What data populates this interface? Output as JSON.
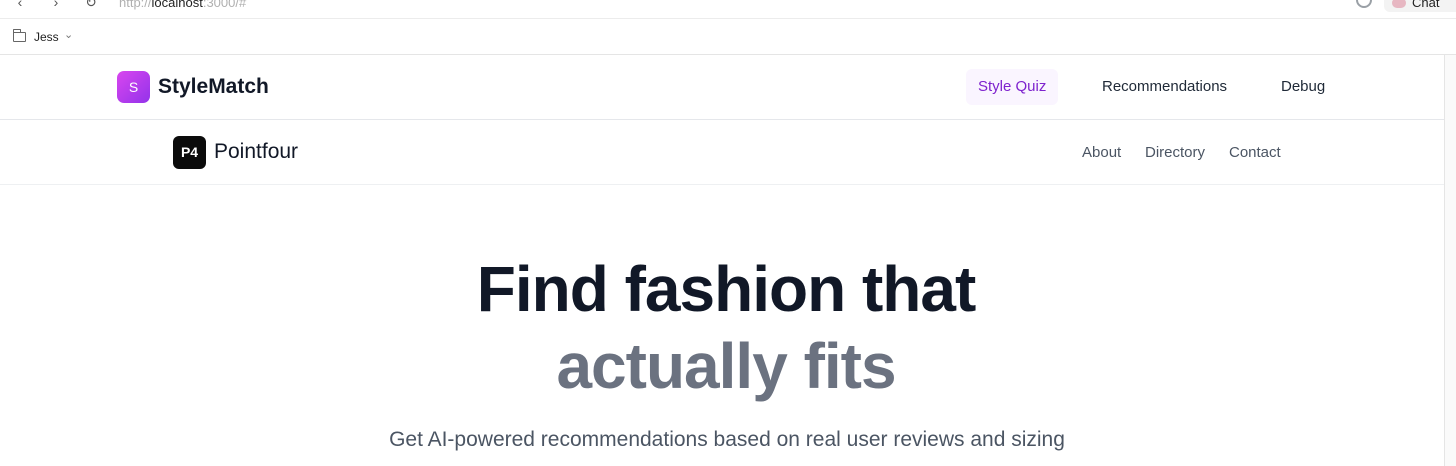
{
  "browser": {
    "url_scheme": "http://",
    "url_host": "localhost",
    "url_rest": ":3000/#",
    "chat_label": "Chat"
  },
  "bookmarks": {
    "folder_label": "Jess"
  },
  "app_header": {
    "logo_letter": "S",
    "brand_name": "StyleMatch",
    "nav": [
      {
        "label": "Style Quiz",
        "active": true
      },
      {
        "label": "Recommendations",
        "active": false
      },
      {
        "label": "Debug",
        "active": false
      }
    ],
    "accent_color": "#9333ea"
  },
  "site_header": {
    "logo_text": "P4",
    "brand_name": "Pointfour",
    "nav": [
      {
        "label": "About"
      },
      {
        "label": "Directory"
      },
      {
        "label": "Contact"
      }
    ]
  },
  "hero": {
    "line1": "Find fashion that",
    "line2": "actually fits",
    "subtitle": "Get AI-powered recommendations based on real user reviews and sizing"
  }
}
